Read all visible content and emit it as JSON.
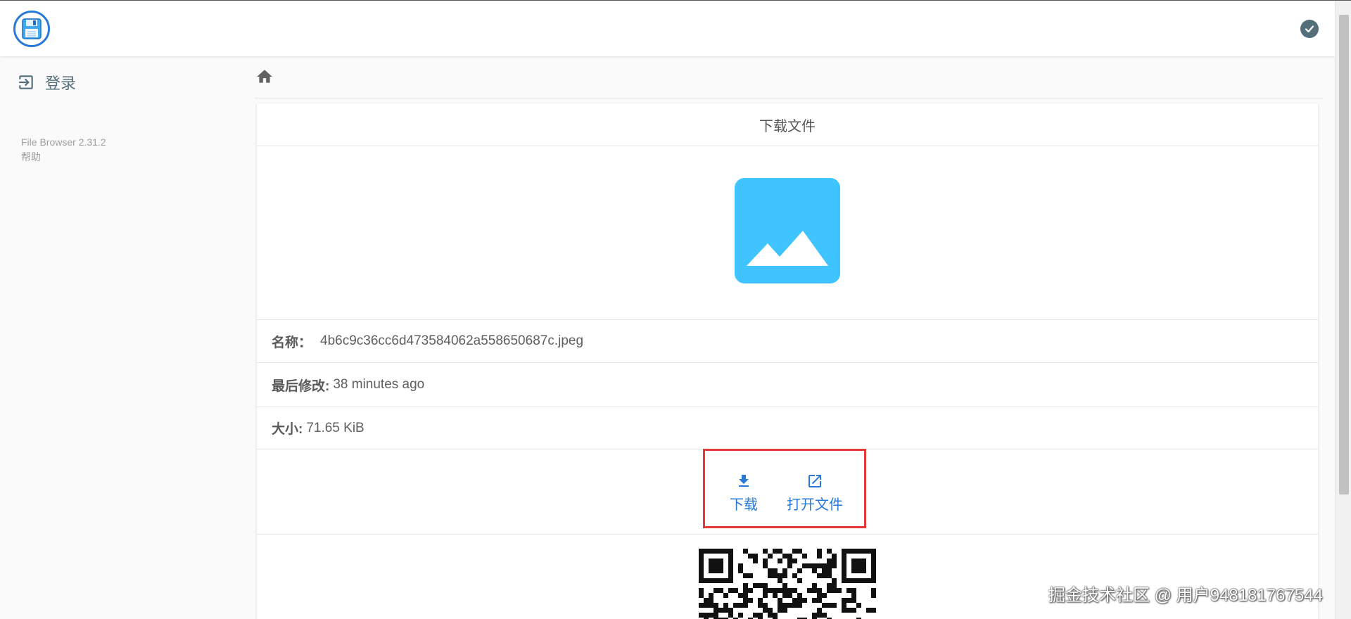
{
  "header": {
    "logo_icon": "floppy-disk-icon",
    "status_icon": "check-circle-icon"
  },
  "sidebar": {
    "login": {
      "icon": "login-icon",
      "label": "登录"
    },
    "credits": {
      "version": "File Browser 2.31.2",
      "help": "帮助"
    }
  },
  "breadcrumb": {
    "home_icon": "home-icon"
  },
  "card": {
    "title": "下载文件",
    "preview_icon": "image-icon",
    "preview_color": "#40c4ff",
    "name_label": "名称：",
    "name_value": "4b6c9c36cc6d473584062a558650687c.jpeg",
    "modified_label": "最后修改:",
    "modified_value": "38 minutes ago",
    "size_label": "大小:",
    "size_value": "71.65 KiB",
    "actions": {
      "download_label": "下载",
      "open_label": "打开文件",
      "accent_color": "#2979d9",
      "highlight_color": "#e53935"
    }
  },
  "watermark": "掘金技术社区 @ 用户948181767544"
}
